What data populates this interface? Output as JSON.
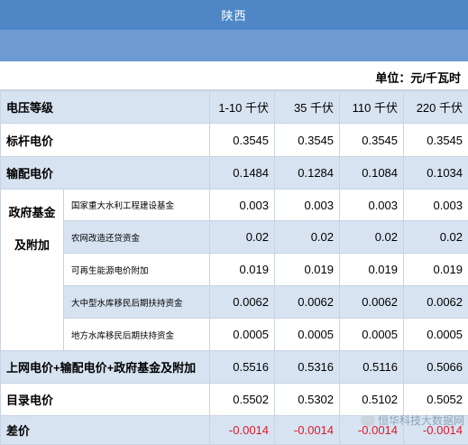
{
  "title": "陕西",
  "unit": "单位：元/千瓦时",
  "header": {
    "label": "电压等级",
    "cols": [
      "1-10 千伏",
      "35 千伏",
      "110 千伏",
      "220 千伏"
    ]
  },
  "rows": {
    "benchmark": {
      "label": "标杆电价",
      "values": [
        "0.3545",
        "0.3545",
        "0.3545",
        "0.3545"
      ]
    },
    "transmission": {
      "label": "输配电价",
      "values": [
        "0.1484",
        "0.1284",
        "0.1084",
        "0.1034"
      ]
    },
    "fund_group": {
      "label_line1": "政府基金",
      "label_line2": "及附加"
    },
    "fund1": {
      "label": "国家重大水利工程建设基金",
      "values": [
        "0.003",
        "0.003",
        "0.003",
        "0.003"
      ]
    },
    "fund2": {
      "label": "农网改造还贷资金",
      "values": [
        "0.02",
        "0.02",
        "0.02",
        "0.02"
      ]
    },
    "fund3": {
      "label": "可再生能源电价附加",
      "values": [
        "0.019",
        "0.019",
        "0.019",
        "0.019"
      ]
    },
    "fund4": {
      "label": "大中型水库移民后期扶持资金",
      "values": [
        "0.0062",
        "0.0062",
        "0.0062",
        "0.0062"
      ]
    },
    "fund5": {
      "label": "地方水库移民后期扶持资金",
      "values": [
        "0.0005",
        "0.0005",
        "0.0005",
        "0.0005"
      ]
    },
    "total": {
      "label": "上网电价+输配电价+政府基金及附加",
      "values": [
        "0.5516",
        "0.5316",
        "0.5116",
        "0.5066"
      ]
    },
    "catalog": {
      "label": "目录电价",
      "values": [
        "0.5502",
        "0.5302",
        "0.5102",
        "0.5052"
      ]
    },
    "diff": {
      "label": "差价",
      "values": [
        "-0.0014",
        "-0.0014",
        "-0.0014",
        "-0.0014"
      ]
    }
  },
  "colors": {
    "title_bg": "#4f87c6",
    "shade": "#d7e3f1",
    "negative": "#e0182b"
  },
  "watermark": "恒华科技大数据网"
}
